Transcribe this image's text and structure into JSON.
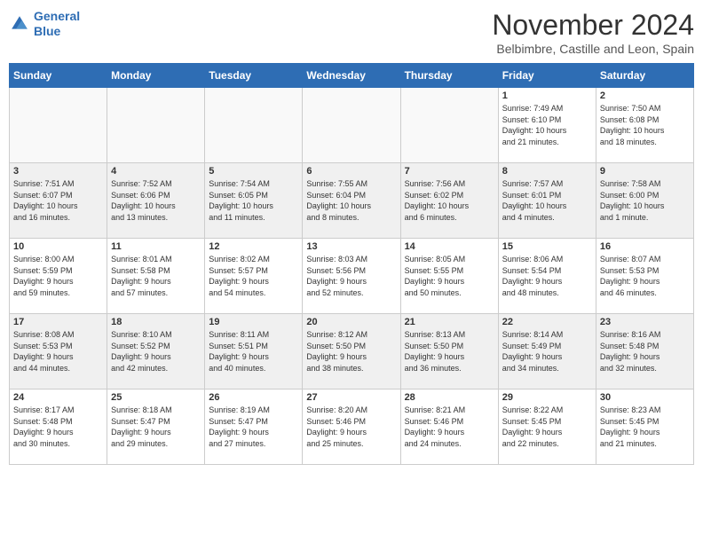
{
  "header": {
    "logo_line1": "General",
    "logo_line2": "Blue",
    "month": "November 2024",
    "location": "Belbimbre, Castille and Leon, Spain"
  },
  "days_of_week": [
    "Sunday",
    "Monday",
    "Tuesday",
    "Wednesday",
    "Thursday",
    "Friday",
    "Saturday"
  ],
  "weeks": [
    [
      {
        "day": "",
        "info": ""
      },
      {
        "day": "",
        "info": ""
      },
      {
        "day": "",
        "info": ""
      },
      {
        "day": "",
        "info": ""
      },
      {
        "day": "",
        "info": ""
      },
      {
        "day": "1",
        "info": "Sunrise: 7:49 AM\nSunset: 6:10 PM\nDaylight: 10 hours\nand 21 minutes."
      },
      {
        "day": "2",
        "info": "Sunrise: 7:50 AM\nSunset: 6:08 PM\nDaylight: 10 hours\nand 18 minutes."
      }
    ],
    [
      {
        "day": "3",
        "info": "Sunrise: 7:51 AM\nSunset: 6:07 PM\nDaylight: 10 hours\nand 16 minutes."
      },
      {
        "day": "4",
        "info": "Sunrise: 7:52 AM\nSunset: 6:06 PM\nDaylight: 10 hours\nand 13 minutes."
      },
      {
        "day": "5",
        "info": "Sunrise: 7:54 AM\nSunset: 6:05 PM\nDaylight: 10 hours\nand 11 minutes."
      },
      {
        "day": "6",
        "info": "Sunrise: 7:55 AM\nSunset: 6:04 PM\nDaylight: 10 hours\nand 8 minutes."
      },
      {
        "day": "7",
        "info": "Sunrise: 7:56 AM\nSunset: 6:02 PM\nDaylight: 10 hours\nand 6 minutes."
      },
      {
        "day": "8",
        "info": "Sunrise: 7:57 AM\nSunset: 6:01 PM\nDaylight: 10 hours\nand 4 minutes."
      },
      {
        "day": "9",
        "info": "Sunrise: 7:58 AM\nSunset: 6:00 PM\nDaylight: 10 hours\nand 1 minute."
      }
    ],
    [
      {
        "day": "10",
        "info": "Sunrise: 8:00 AM\nSunset: 5:59 PM\nDaylight: 9 hours\nand 59 minutes."
      },
      {
        "day": "11",
        "info": "Sunrise: 8:01 AM\nSunset: 5:58 PM\nDaylight: 9 hours\nand 57 minutes."
      },
      {
        "day": "12",
        "info": "Sunrise: 8:02 AM\nSunset: 5:57 PM\nDaylight: 9 hours\nand 54 minutes."
      },
      {
        "day": "13",
        "info": "Sunrise: 8:03 AM\nSunset: 5:56 PM\nDaylight: 9 hours\nand 52 minutes."
      },
      {
        "day": "14",
        "info": "Sunrise: 8:05 AM\nSunset: 5:55 PM\nDaylight: 9 hours\nand 50 minutes."
      },
      {
        "day": "15",
        "info": "Sunrise: 8:06 AM\nSunset: 5:54 PM\nDaylight: 9 hours\nand 48 minutes."
      },
      {
        "day": "16",
        "info": "Sunrise: 8:07 AM\nSunset: 5:53 PM\nDaylight: 9 hours\nand 46 minutes."
      }
    ],
    [
      {
        "day": "17",
        "info": "Sunrise: 8:08 AM\nSunset: 5:53 PM\nDaylight: 9 hours\nand 44 minutes."
      },
      {
        "day": "18",
        "info": "Sunrise: 8:10 AM\nSunset: 5:52 PM\nDaylight: 9 hours\nand 42 minutes."
      },
      {
        "day": "19",
        "info": "Sunrise: 8:11 AM\nSunset: 5:51 PM\nDaylight: 9 hours\nand 40 minutes."
      },
      {
        "day": "20",
        "info": "Sunrise: 8:12 AM\nSunset: 5:50 PM\nDaylight: 9 hours\nand 38 minutes."
      },
      {
        "day": "21",
        "info": "Sunrise: 8:13 AM\nSunset: 5:50 PM\nDaylight: 9 hours\nand 36 minutes."
      },
      {
        "day": "22",
        "info": "Sunrise: 8:14 AM\nSunset: 5:49 PM\nDaylight: 9 hours\nand 34 minutes."
      },
      {
        "day": "23",
        "info": "Sunrise: 8:16 AM\nSunset: 5:48 PM\nDaylight: 9 hours\nand 32 minutes."
      }
    ],
    [
      {
        "day": "24",
        "info": "Sunrise: 8:17 AM\nSunset: 5:48 PM\nDaylight: 9 hours\nand 30 minutes."
      },
      {
        "day": "25",
        "info": "Sunrise: 8:18 AM\nSunset: 5:47 PM\nDaylight: 9 hours\nand 29 minutes."
      },
      {
        "day": "26",
        "info": "Sunrise: 8:19 AM\nSunset: 5:47 PM\nDaylight: 9 hours\nand 27 minutes."
      },
      {
        "day": "27",
        "info": "Sunrise: 8:20 AM\nSunset: 5:46 PM\nDaylight: 9 hours\nand 25 minutes."
      },
      {
        "day": "28",
        "info": "Sunrise: 8:21 AM\nSunset: 5:46 PM\nDaylight: 9 hours\nand 24 minutes."
      },
      {
        "day": "29",
        "info": "Sunrise: 8:22 AM\nSunset: 5:45 PM\nDaylight: 9 hours\nand 22 minutes."
      },
      {
        "day": "30",
        "info": "Sunrise: 8:23 AM\nSunset: 5:45 PM\nDaylight: 9 hours\nand 21 minutes."
      }
    ]
  ]
}
